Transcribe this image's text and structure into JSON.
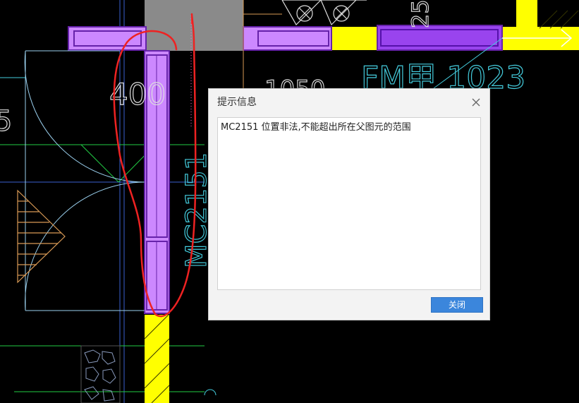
{
  "drawing": {
    "dim_label_400": "400",
    "dim_label_1050": "1050",
    "door_tag_fm": "FM甲 1023",
    "door_tag_mc": "MC2151",
    "dim_label_25": "25",
    "left_edge_digit": "5",
    "colors": {
      "wall_yellow": "#ffff00",
      "selected_purple": "#cc88ff",
      "selected_purple_dark": "#8833dd",
      "gray_block": "#8a8a8a",
      "cyan_lines": "#44ccdd",
      "annotation_red": "#ee2222",
      "hatch_orange": "#d99a55",
      "green_lines": "#22cc44"
    }
  },
  "dialog": {
    "title": "提示信息",
    "close_icon": "close-icon",
    "message": "MC2151 位置非法,不能超出所在父图元的范围",
    "close_button_label": "关闭"
  }
}
